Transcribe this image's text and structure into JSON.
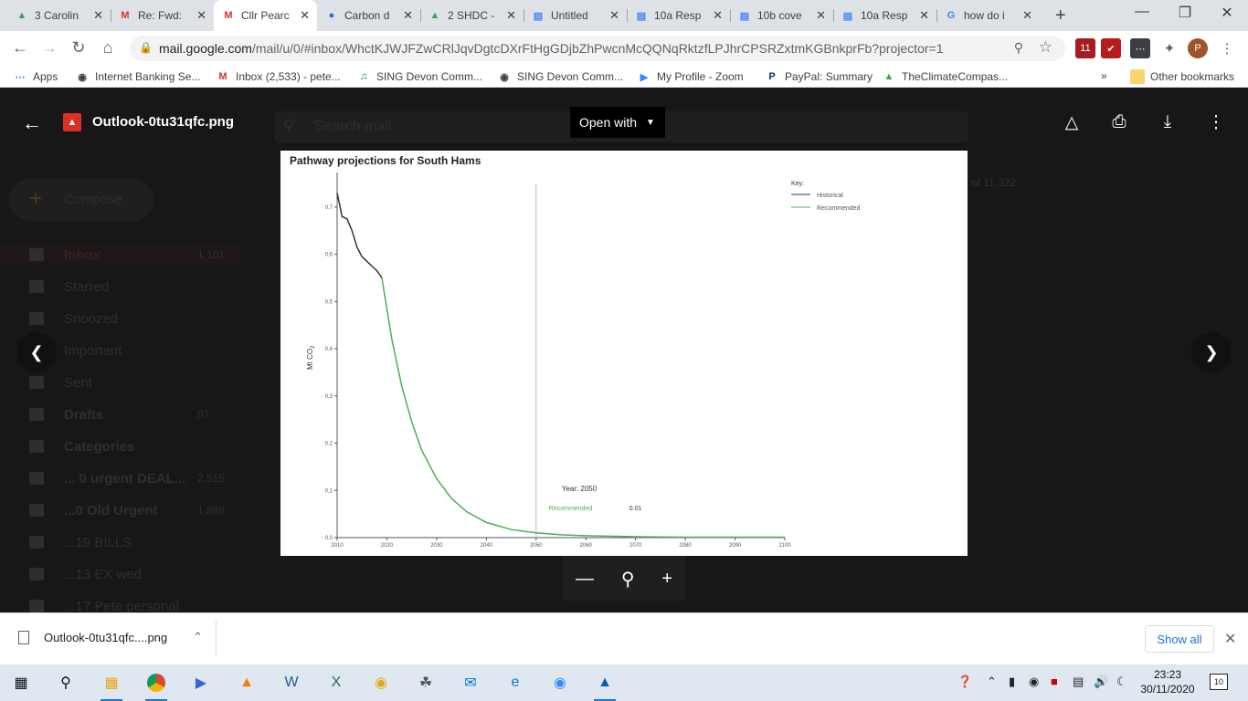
{
  "browser": {
    "tabs": [
      {
        "label": "3 Carolin",
        "icon": "drive-icon",
        "color": "#34a853",
        "active": false
      },
      {
        "label": "Re: Fwd:",
        "icon": "gmail-icon",
        "color": "#d93025",
        "active": false
      },
      {
        "label": "Cllr Pearc",
        "icon": "gmail-icon",
        "color": "#d93025",
        "active": true
      },
      {
        "label": "Carbon d",
        "icon": "doc-blue-icon",
        "color": "#1a73e8",
        "active": false
      },
      {
        "label": "2 SHDC -",
        "icon": "drive-icon",
        "color": "#34a853",
        "active": false
      },
      {
        "label": "Untitled",
        "icon": "docs-icon",
        "color": "#4285f4",
        "active": false
      },
      {
        "label": "10a Resp",
        "icon": "docs-icon",
        "color": "#4285f4",
        "active": false
      },
      {
        "label": "10b cove",
        "icon": "docs-icon",
        "color": "#4285f4",
        "active": false
      },
      {
        "label": "10a Resp",
        "icon": "docs-icon",
        "color": "#4285f4",
        "active": false
      },
      {
        "label": "how do i",
        "icon": "google-icon",
        "color": "#4285f4",
        "active": false
      }
    ],
    "url_host": "mail.google.com",
    "url_path": "/mail/u/0/#inbox/WhctKJWJFZwCRlJqvDgtcDXrFtHgGDjbZhPwcnMcQQNqRktzfLPJhrCPSRZxtmKGBnkprFb?projector=1",
    "extension_badge": "11",
    "profile_initial": "P",
    "bookmarks": [
      {
        "label": "Apps",
        "icon": "apps-grid-icon"
      },
      {
        "label": "Internet Banking Se...",
        "icon": "globe-icon"
      },
      {
        "label": "Inbox (2,533) - pete...",
        "icon": "gmail-icon"
      },
      {
        "label": "SING Devon Comm...",
        "icon": "music-note-icon"
      },
      {
        "label": "SING Devon Comm...",
        "icon": "globe-icon"
      },
      {
        "label": "My Profile - Zoom",
        "icon": "zoom-icon"
      },
      {
        "label": "PayPal: Summary",
        "icon": "paypal-icon"
      },
      {
        "label": "TheClimateCompas...",
        "icon": "drive-icon"
      }
    ],
    "bookmarks_overflow": "»",
    "other_bookmarks": "Other bookmarks"
  },
  "gmail_background": {
    "search_placeholder": "Search mail",
    "compose": "Compose",
    "pagination": "of 11,322",
    "sidebar": [
      {
        "label": "Inbox",
        "count": "1,101"
      },
      {
        "label": "Starred",
        "count": ""
      },
      {
        "label": "Snoozed",
        "count": ""
      },
      {
        "label": "Important",
        "count": ""
      },
      {
        "label": "Sent",
        "count": ""
      },
      {
        "label": "Drafts",
        "count": "97"
      },
      {
        "label": "Categories",
        "count": ""
      },
      {
        "label": "... 0 urgent DEAL...",
        "count": "2,515"
      },
      {
        "label": "...0 Old Urgent",
        "count": "1,888"
      },
      {
        "label": "...19 BILLS",
        "count": ""
      },
      {
        "label": "...13 EX wed",
        "count": ""
      },
      {
        "label": "...17 Pete personal",
        "count": ""
      }
    ]
  },
  "viewer": {
    "filename": "Outlook-0tu31qfc.png",
    "open_with": "Open with"
  },
  "chart_data": {
    "type": "line",
    "title": "Pathway projections for South Hams",
    "ylabel": "Mt CO",
    "ylabel_sub": "2",
    "xlim": [
      2010,
      2100
    ],
    "ylim": [
      0,
      0.75
    ],
    "xticks": [
      "2010",
      "2020",
      "2030",
      "2040",
      "2050",
      "2060",
      "2070",
      "2080",
      "2090",
      "2100"
    ],
    "yticks": [
      "0.0",
      "0.1",
      "0.2",
      "0.3",
      "0.4",
      "0.5",
      "0.6",
      "0.7"
    ],
    "legend_title": "Key:",
    "legend_position": "top-right",
    "series": [
      {
        "name": "Historical",
        "color": "#333333",
        "x": [
          2010,
          2011,
          2012,
          2013,
          2014,
          2015,
          2016,
          2017,
          2018,
          2019
        ],
        "y": [
          0.73,
          0.68,
          0.675,
          0.65,
          0.615,
          0.595,
          0.585,
          0.575,
          0.565,
          0.55
        ]
      },
      {
        "name": "Recommended",
        "color": "#4caf50",
        "x": [
          2019,
          2021,
          2023,
          2025,
          2027,
          2030,
          2033,
          2036,
          2040,
          2045,
          2050,
          2055,
          2060,
          2070,
          2080,
          2090,
          2100
        ],
        "y": [
          0.55,
          0.42,
          0.32,
          0.245,
          0.185,
          0.125,
          0.083,
          0.055,
          0.032,
          0.017,
          0.01,
          0.006,
          0.004,
          0.002,
          0.001,
          0.001,
          0.001
        ]
      }
    ],
    "marker_year": 2050,
    "marker_label": "Year: 2050",
    "marker_series": "Recommended",
    "marker_value": "0.01"
  },
  "download": {
    "filename": "Outlook-0tu31qfc....png",
    "show_all": "Show all"
  },
  "taskbar": {
    "time": "23:23",
    "date": "30/11/2020",
    "notification_count": "10"
  }
}
